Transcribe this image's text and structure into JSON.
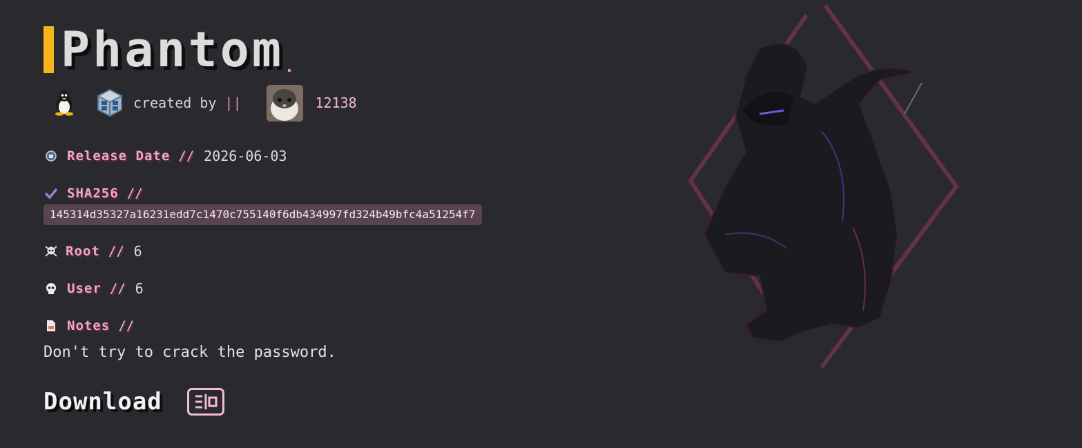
{
  "machine": {
    "title": "Phantom",
    "created_by_label": "created by",
    "creator_separator": "||",
    "views": "12138",
    "icons": {
      "os": "linux-tux-icon",
      "platform": "virtualbox-icon",
      "avatar": "hamster-avatar"
    }
  },
  "fields": {
    "release": {
      "label": "Release Date",
      "sep": "//",
      "value": "2026-06-03"
    },
    "sha": {
      "label": "SHA256",
      "sep": "//",
      "value": "145314d35327a16231edd7c1470c755140f6db434997fd324b49bfc4a51254f7"
    },
    "root": {
      "label": "Root",
      "sep": "//",
      "value": "6"
    },
    "user": {
      "label": "User",
      "sep": "//",
      "value": "6"
    },
    "notes": {
      "label": "Notes",
      "sep": "//",
      "value": "Don't try to crack the password."
    }
  },
  "download": {
    "label": "Download"
  },
  "colors": {
    "background": "#2a292e",
    "accent_yellow": "#f3b51a",
    "accent_pink": "#f3a7c6",
    "hash_bg": "#5a4350"
  }
}
